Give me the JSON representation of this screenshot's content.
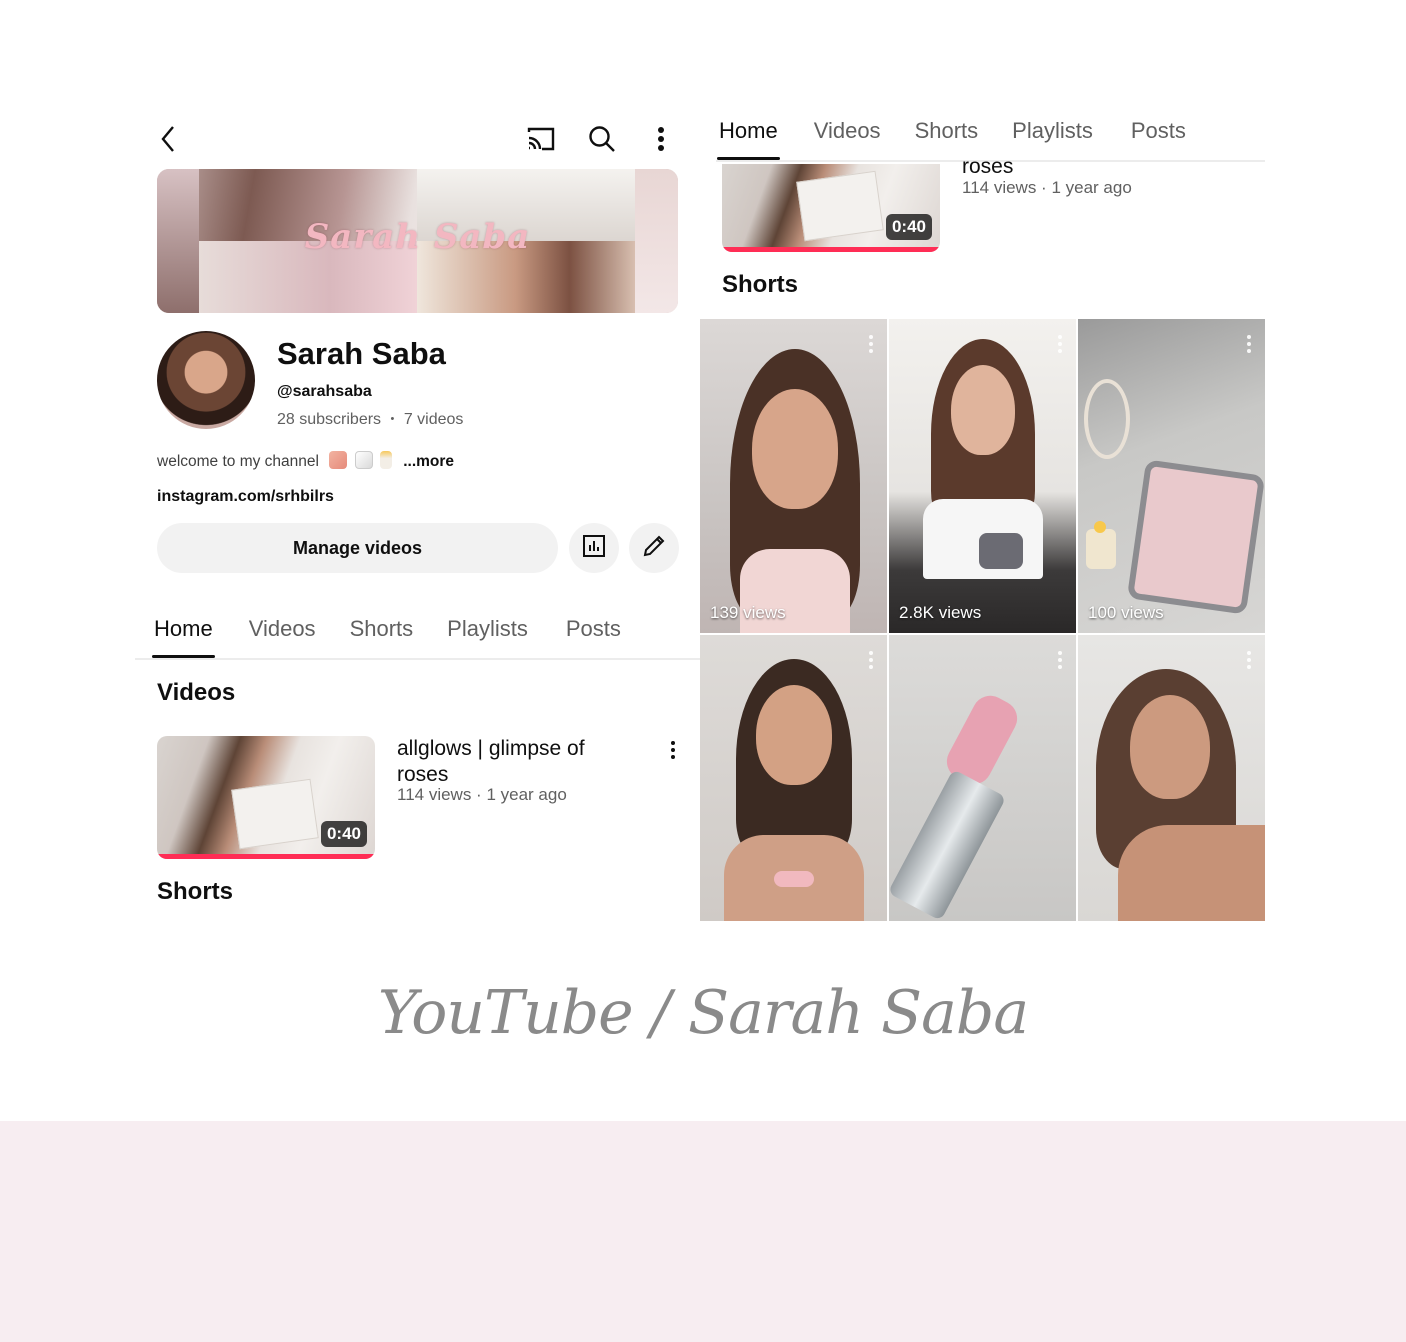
{
  "left": {
    "banner_title": "Sarah Saba",
    "channel": {
      "name": "Sarah Saba",
      "handle": "@sarahsaba",
      "subscribers": "28 subscribers",
      "separator": "•",
      "videos": "7 videos",
      "description": "welcome to my channel",
      "more": "...more",
      "link": "instagram.com/srhbilrs"
    },
    "manage_button": "Manage videos",
    "tabs": [
      "Home",
      "Videos",
      "Shorts",
      "Playlists",
      "Posts"
    ],
    "videos_section": "Videos",
    "video": {
      "title_line1": "allglows | glimpse of",
      "title_line2": "roses",
      "meta": "114 views · 1 year ago",
      "duration": "0:40"
    },
    "shorts_section": "Shorts"
  },
  "right": {
    "tabs": [
      "Home",
      "Videos",
      "Shorts",
      "Playlists",
      "Posts"
    ],
    "video": {
      "title_tail": "roses",
      "meta": "114 views · 1 year ago",
      "duration": "0:40"
    },
    "shorts_section": "Shorts",
    "shorts": [
      {
        "views": "139 views"
      },
      {
        "views": "2.8K views"
      },
      {
        "views": "100 views"
      },
      {
        "views": ""
      },
      {
        "views": ""
      },
      {
        "views": ""
      }
    ]
  },
  "caption": "YouTube / Sarah Saba",
  "colors": {
    "accent_progress": "#ff2d55",
    "footer_band": "#f7edf1",
    "text_secondary": "#606060"
  }
}
